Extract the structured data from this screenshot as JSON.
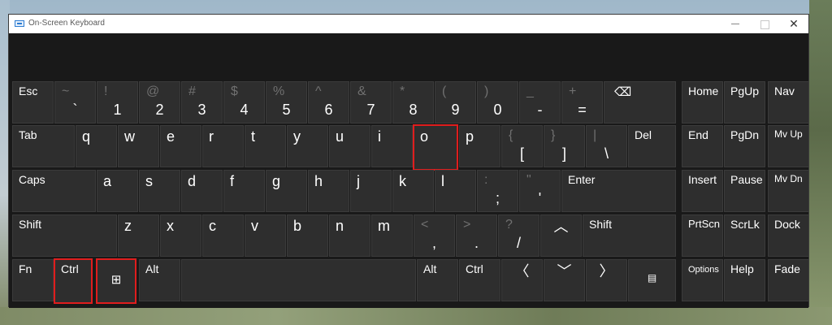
{
  "window": {
    "title": "On-Screen Keyboard"
  },
  "title_controls": {
    "close_glyph": "✕"
  },
  "rows": {
    "num": [
      {
        "top": "Esc"
      },
      {
        "shift": "~",
        "base": "`"
      },
      {
        "shift": "!",
        "base": "1"
      },
      {
        "shift": "@",
        "base": "2"
      },
      {
        "shift": "#",
        "base": "3"
      },
      {
        "shift": "$",
        "base": "4"
      },
      {
        "shift": "%",
        "base": "5"
      },
      {
        "shift": "^",
        "base": "6"
      },
      {
        "shift": "&",
        "base": "7"
      },
      {
        "shift": "*",
        "base": "8"
      },
      {
        "shift": "(",
        "base": "9"
      },
      {
        "shift": ")",
        "base": "0"
      },
      {
        "shift": "_",
        "base": "-"
      },
      {
        "shift": "+",
        "base": "="
      }
    ],
    "tab": [
      {
        "top": "Tab"
      },
      {
        "letter": "q"
      },
      {
        "letter": "w"
      },
      {
        "letter": "e"
      },
      {
        "letter": "r"
      },
      {
        "letter": "t"
      },
      {
        "letter": "y"
      },
      {
        "letter": "u"
      },
      {
        "letter": "i"
      },
      {
        "letter": "o"
      },
      {
        "letter": "p"
      },
      {
        "shift": "{",
        "base": "["
      },
      {
        "shift": "}",
        "base": "]"
      },
      {
        "shift": "|",
        "base": "\\"
      },
      {
        "top": "Del"
      }
    ],
    "caps": [
      {
        "top": "Caps"
      },
      {
        "letter": "a"
      },
      {
        "letter": "s"
      },
      {
        "letter": "d"
      },
      {
        "letter": "f"
      },
      {
        "letter": "g"
      },
      {
        "letter": "h"
      },
      {
        "letter": "j"
      },
      {
        "letter": "k"
      },
      {
        "letter": "l"
      },
      {
        "shift": ":",
        "base": ";"
      },
      {
        "shift": "\"",
        "base": "'"
      },
      {
        "top": "Enter"
      }
    ],
    "shift": [
      {
        "top": "Shift"
      },
      {
        "letter": "z"
      },
      {
        "letter": "x"
      },
      {
        "letter": "c"
      },
      {
        "letter": "v"
      },
      {
        "letter": "b"
      },
      {
        "letter": "n"
      },
      {
        "letter": "m"
      },
      {
        "shift": "<",
        "base": ","
      },
      {
        "shift": ">",
        "base": "."
      },
      {
        "shift": "?",
        "base": "/"
      },
      {
        "top": "Shift"
      }
    ],
    "bottom": [
      {
        "top": "Fn"
      },
      {
        "top": "Ctrl"
      },
      {
        "top": "Alt"
      },
      {
        "top": "Alt"
      },
      {
        "top": "Ctrl"
      }
    ]
  },
  "nav": {
    "home": "Home",
    "pgup": "PgUp",
    "nav": "Nav",
    "end": "End",
    "pgdn": "PgDn",
    "mvup": "Mv Up",
    "insert": "Insert",
    "pause": "Pause",
    "mvdn": "Mv Dn",
    "prtscn": "PrtScn",
    "scrlk": "ScrLk",
    "dock": "Dock",
    "options": "Options",
    "help": "Help",
    "fade": "Fade"
  },
  "glyphs": {
    "backspace": "⌫",
    "up": "︿",
    "down": "﹀",
    "left": "〈",
    "right": "〉",
    "windows": "⊞",
    "menu": "▤"
  },
  "highlight_color": "#e01d1d"
}
